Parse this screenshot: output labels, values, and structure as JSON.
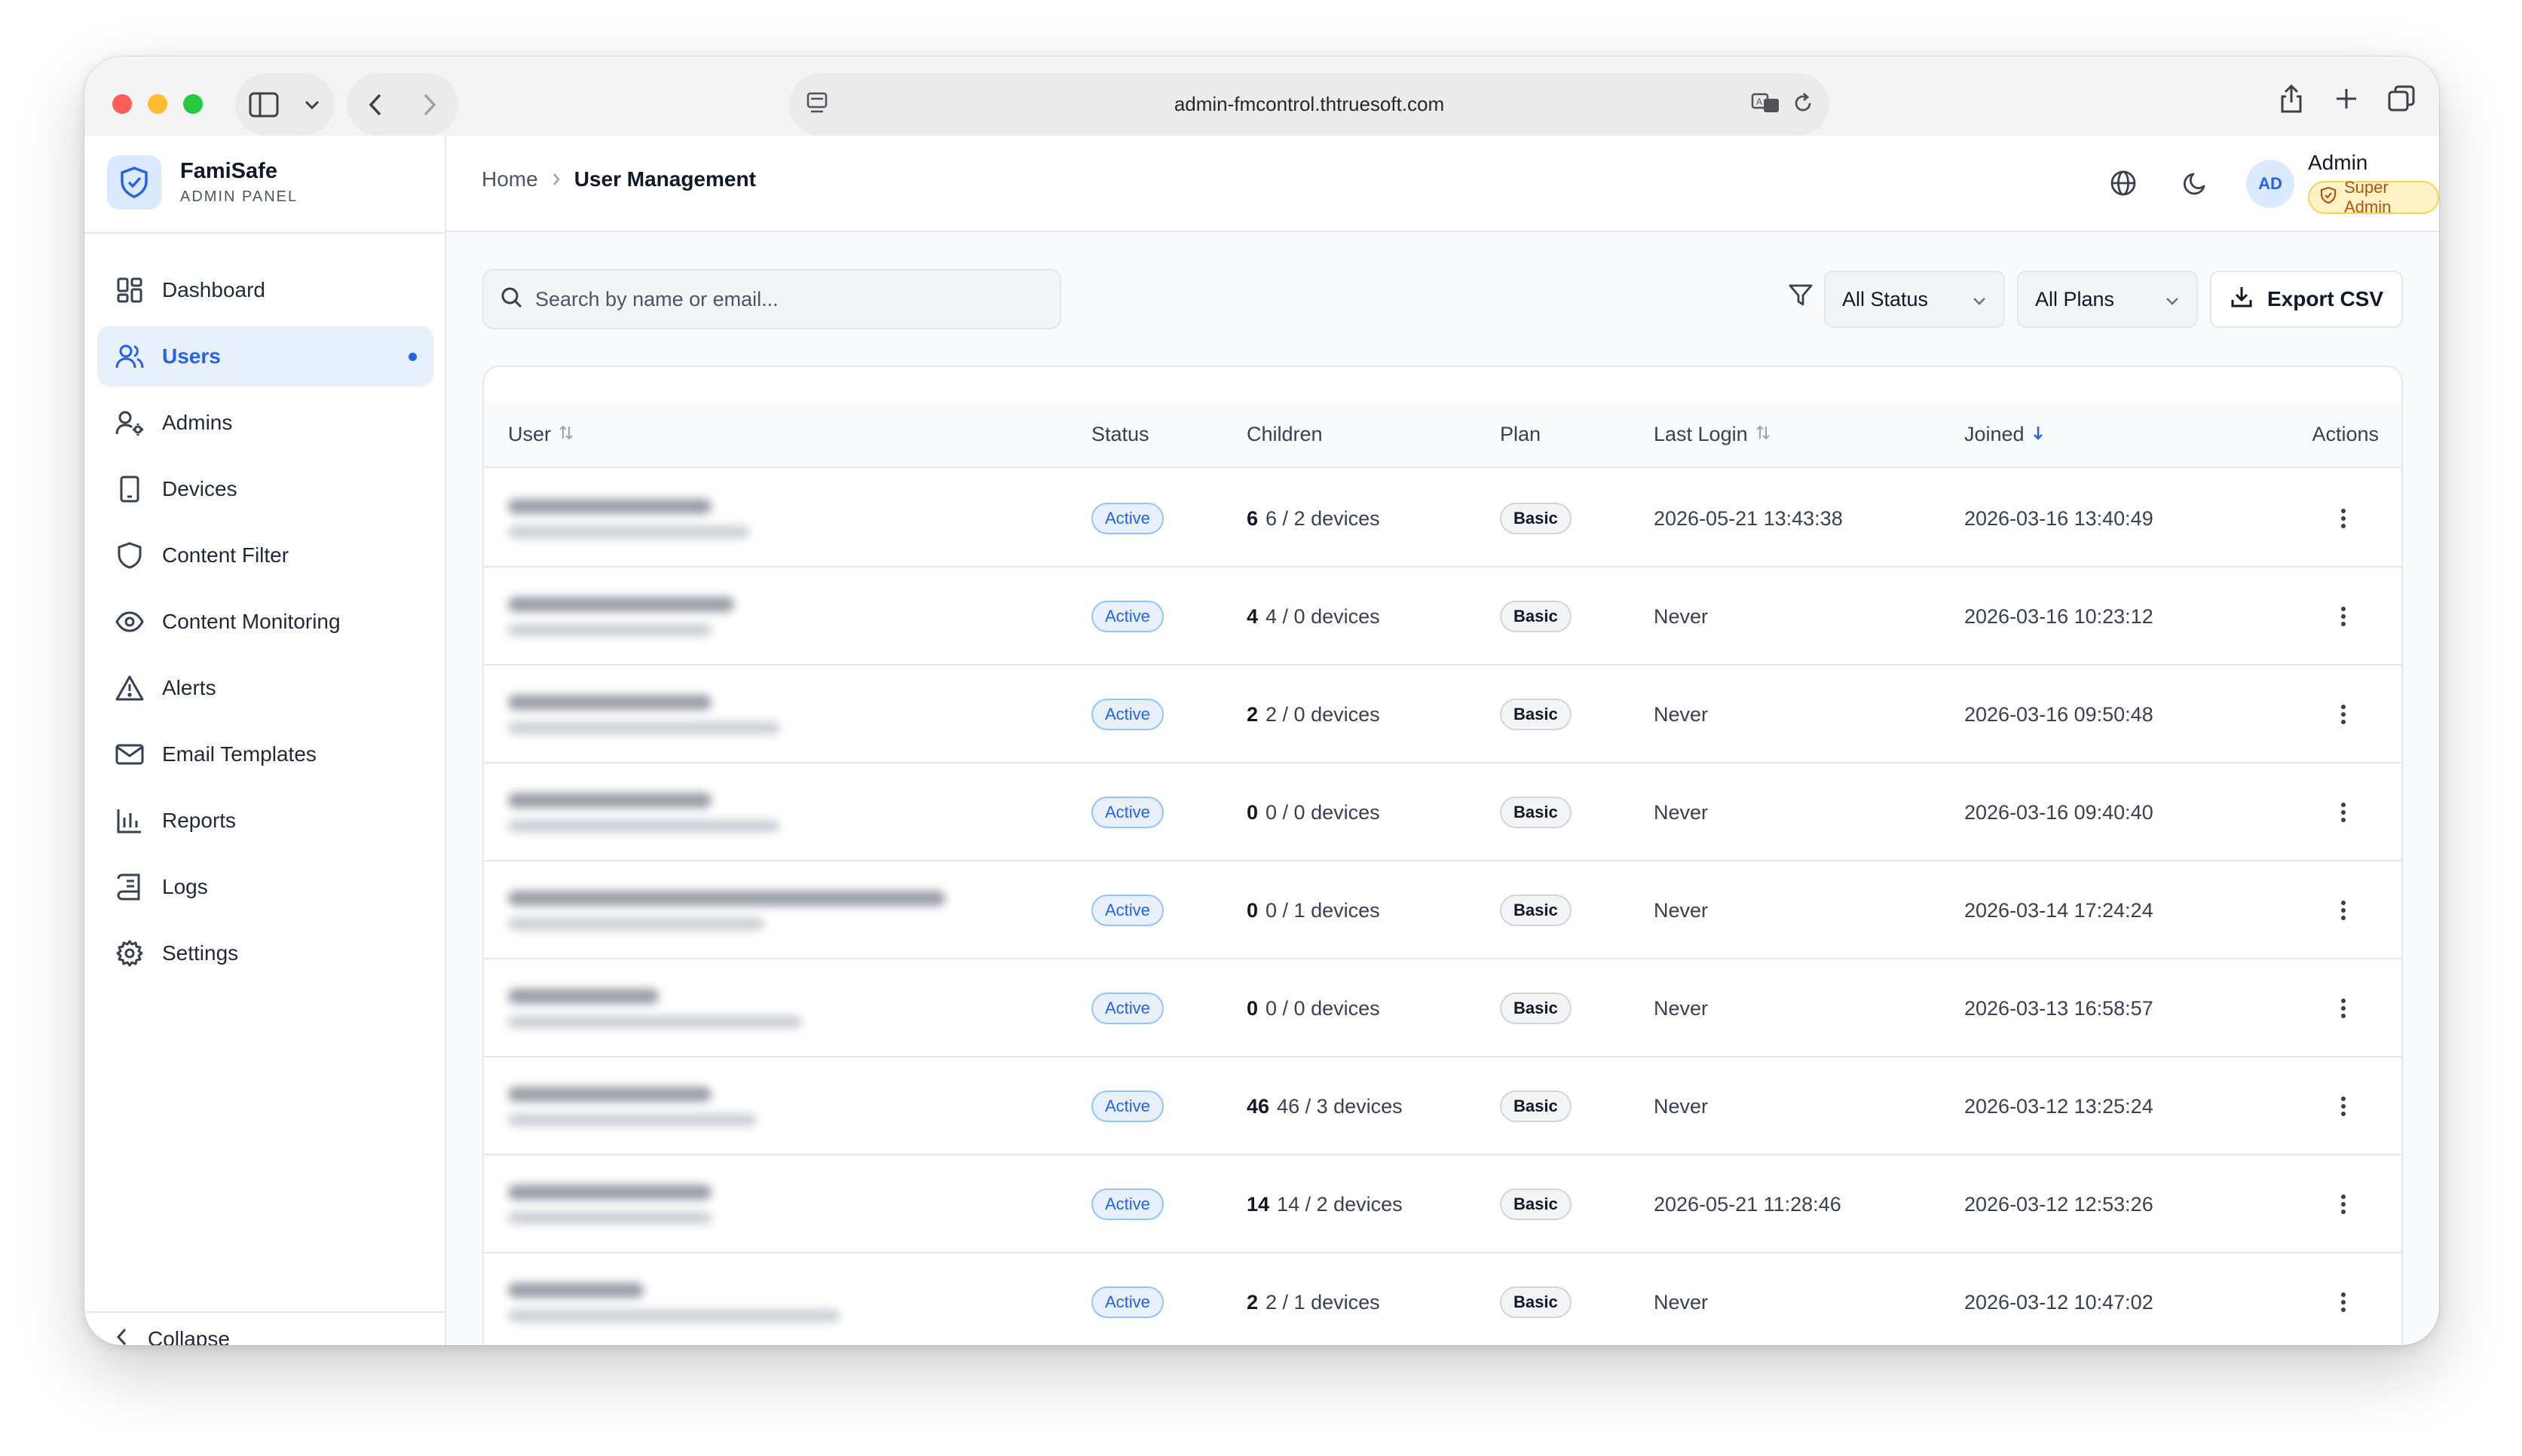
{
  "browser": {
    "url": "admin-fmcontrol.thtruesoft.com"
  },
  "brand": {
    "name": "FamiSafe",
    "subtitle": "ADMIN PANEL"
  },
  "sidebar": {
    "items": [
      {
        "label": "Dashboard",
        "icon": "dashboard-icon",
        "active": false
      },
      {
        "label": "Users",
        "icon": "users-icon",
        "active": true
      },
      {
        "label": "Admins",
        "icon": "admins-icon",
        "active": false
      },
      {
        "label": "Devices",
        "icon": "devices-icon",
        "active": false
      },
      {
        "label": "Content Filter",
        "icon": "shield-icon",
        "active": false
      },
      {
        "label": "Content Monitoring",
        "icon": "eye-icon",
        "active": false
      },
      {
        "label": "Alerts",
        "icon": "alert-triangle-icon",
        "active": false
      },
      {
        "label": "Email Templates",
        "icon": "mail-icon",
        "active": false
      },
      {
        "label": "Reports",
        "icon": "bar-chart-icon",
        "active": false
      },
      {
        "label": "Logs",
        "icon": "logs-icon",
        "active": false
      },
      {
        "label": "Settings",
        "icon": "gear-icon",
        "active": false
      }
    ],
    "collapse_label": "Collapse"
  },
  "header": {
    "breadcrumb": {
      "home": "Home",
      "current": "User Management"
    },
    "user": {
      "initials": "AD",
      "name": "Admin",
      "role": "Super Admin"
    }
  },
  "toolbar": {
    "search_placeholder": "Search by name or email...",
    "status_filter": "All Status",
    "plan_filter": "All Plans",
    "export_label": "Export CSV"
  },
  "table": {
    "columns": {
      "user": "User",
      "status": "Status",
      "children": "Children",
      "plan": "Plan",
      "last_login": "Last Login",
      "joined": "Joined",
      "actions": "Actions"
    },
    "rows": [
      {
        "status": "Active",
        "children_count": "6",
        "children_detail": "6 / 2 devices",
        "plan": "Basic",
        "last_login": "2026-05-21 13:43:38",
        "joined": "2026-03-16 13:40:49"
      },
      {
        "status": "Active",
        "children_count": "4",
        "children_detail": "4 / 0 devices",
        "plan": "Basic",
        "last_login": "Never",
        "joined": "2026-03-16 10:23:12"
      },
      {
        "status": "Active",
        "children_count": "2",
        "children_detail": "2 / 0 devices",
        "plan": "Basic",
        "last_login": "Never",
        "joined": "2026-03-16 09:50:48"
      },
      {
        "status": "Active",
        "children_count": "0",
        "children_detail": "0 / 0 devices",
        "plan": "Basic",
        "last_login": "Never",
        "joined": "2026-03-16 09:40:40"
      },
      {
        "status": "Active",
        "children_count": "0",
        "children_detail": "0 / 1 devices",
        "plan": "Basic",
        "last_login": "Never",
        "joined": "2026-03-14 17:24:24"
      },
      {
        "status": "Active",
        "children_count": "0",
        "children_detail": "0 / 0 devices",
        "plan": "Basic",
        "last_login": "Never",
        "joined": "2026-03-13 16:58:57"
      },
      {
        "status": "Active",
        "children_count": "46",
        "children_detail": "46 / 3 devices",
        "plan": "Basic",
        "last_login": "Never",
        "joined": "2026-03-12 13:25:24"
      },
      {
        "status": "Active",
        "children_count": "14",
        "children_detail": "14 / 2 devices",
        "plan": "Basic",
        "last_login": "2026-05-21 11:28:46",
        "joined": "2026-03-12 12:53:26"
      },
      {
        "status": "Active",
        "children_count": "2",
        "children_detail": "2 / 1 devices",
        "plan": "Basic",
        "last_login": "Never",
        "joined": "2026-03-12 10:47:02"
      }
    ]
  },
  "colors": {
    "accent": "#2563eb",
    "active_bg": "#e8f0fc",
    "role_badge_bg": "#fef3c7",
    "role_badge_text": "#b45309"
  }
}
